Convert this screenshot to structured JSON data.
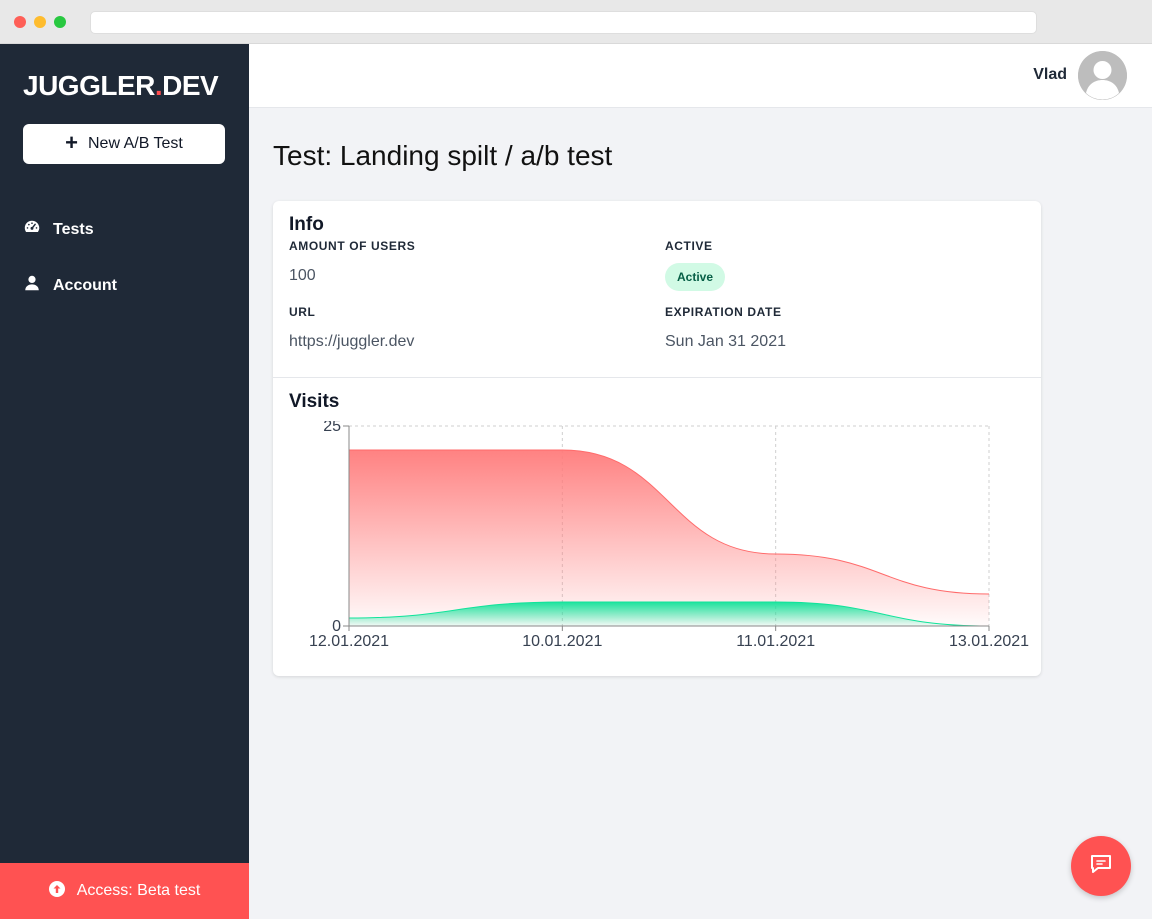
{
  "app": {
    "logo_main": "JUGGLER",
    "logo_dot": ".",
    "logo_suffix": "DEV"
  },
  "sidebar": {
    "new_test_label": "New A/B Test",
    "items": [
      {
        "label": "Tests",
        "icon": "dashboard-gauge-icon"
      },
      {
        "label": "Account",
        "icon": "user-icon"
      }
    ],
    "beta_label": "Access: Beta test",
    "beta_icon": "arrow-up-circle-icon"
  },
  "header": {
    "user_name": "Vlad",
    "avatar_icon": "user-avatar-icon"
  },
  "page": {
    "title": "Test: Landing spilt / a/b test"
  },
  "info": {
    "title": "Info",
    "users_label": "AMOUNT OF USERS",
    "users_value": "100",
    "active_label": "ACTIVE",
    "active_badge": "Active",
    "url_label": "URL",
    "url_value": "https://juggler.dev",
    "expiration_label": "EXPIRATION DATE",
    "expiration_value": "Sun Jan 31 2021"
  },
  "visits": {
    "title": "Visits"
  },
  "colors": {
    "sidebar": "#1f2937",
    "accent": "#ff5252",
    "series_a": "#ff6b6b",
    "series_b": "#10e39a"
  },
  "chart_data": {
    "type": "area",
    "categories": [
      "12.01.2021",
      "10.01.2021",
      "11.01.2021",
      "13.01.2021"
    ],
    "series": [
      {
        "values": [
          22,
          22,
          9,
          4
        ]
      },
      {
        "values": [
          1,
          3,
          3,
          0
        ]
      }
    ],
    "ylim": [
      0,
      25
    ],
    "yticks": [
      0,
      25
    ],
    "grid": true
  },
  "chat": {
    "icon": "chat-bubble-icon"
  }
}
